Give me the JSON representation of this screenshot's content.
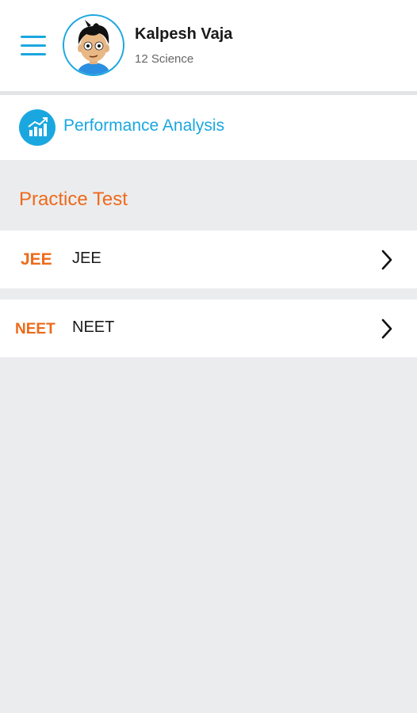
{
  "header": {
    "menu_icon": "hamburger-menu-icon",
    "avatar_icon": "cartoon-boy-avatar",
    "user_name": "Kalpesh Vaja",
    "user_class": "12 Science",
    "accent_color": "#1aa7e0"
  },
  "performance": {
    "icon": "bar-chart-icon",
    "label": "Performance Analysis"
  },
  "practice": {
    "title": "Practice Test",
    "title_color": "#ee6a1a",
    "items": [
      {
        "badge": "JEE",
        "label": "JEE",
        "icon": "chevron-right-icon"
      },
      {
        "badge": "NEET",
        "label": "NEET",
        "icon": "chevron-right-icon"
      }
    ]
  }
}
